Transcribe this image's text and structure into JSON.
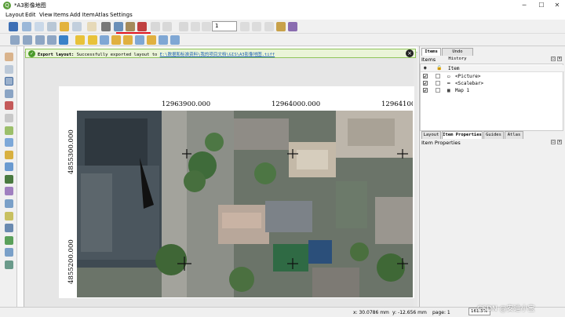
{
  "window": {
    "title": "*A3影像地图"
  },
  "menu": [
    "Layout",
    "Edit",
    "View",
    "Items",
    "Add Item",
    "Atlas",
    "Settings"
  ],
  "toolbar": {
    "page_value": "1"
  },
  "message": {
    "prefix": "Export layout:",
    "text": "Successfully exported layout to",
    "path": "E:\\数据和标准资料\\我的项目文档\\GIS\\A3影像地图.tiff"
  },
  "map": {
    "x_labels": [
      "12963900.000",
      "12964000.000",
      "12964100."
    ],
    "y_labels": [
      "4855300.000",
      "4855200.000"
    ]
  },
  "items_panel": {
    "tabs": [
      "Items",
      "Undo History"
    ],
    "title": "Items",
    "column_header": "Item",
    "rows": [
      {
        "label": "<Picture>",
        "checked": "✔"
      },
      {
        "label": "<Scalebar>",
        "checked": "✔"
      },
      {
        "label": "Map 1",
        "checked": "✔"
      }
    ]
  },
  "props_panel": {
    "tabs": [
      "Layout",
      "Item Properties",
      "Guides",
      "Atlas"
    ],
    "title": "Item Properties"
  },
  "status": {
    "x": "x: 30.0786 mm",
    "y": "y: -12.656 mm",
    "page": "page: 1",
    "zoom": "161.5%"
  },
  "watermark": "CSDN @安迪小宝",
  "colors": {
    "success_bg": "#eaf4d8",
    "success_border": "#8fc45a",
    "link": "#1a5fb4"
  }
}
